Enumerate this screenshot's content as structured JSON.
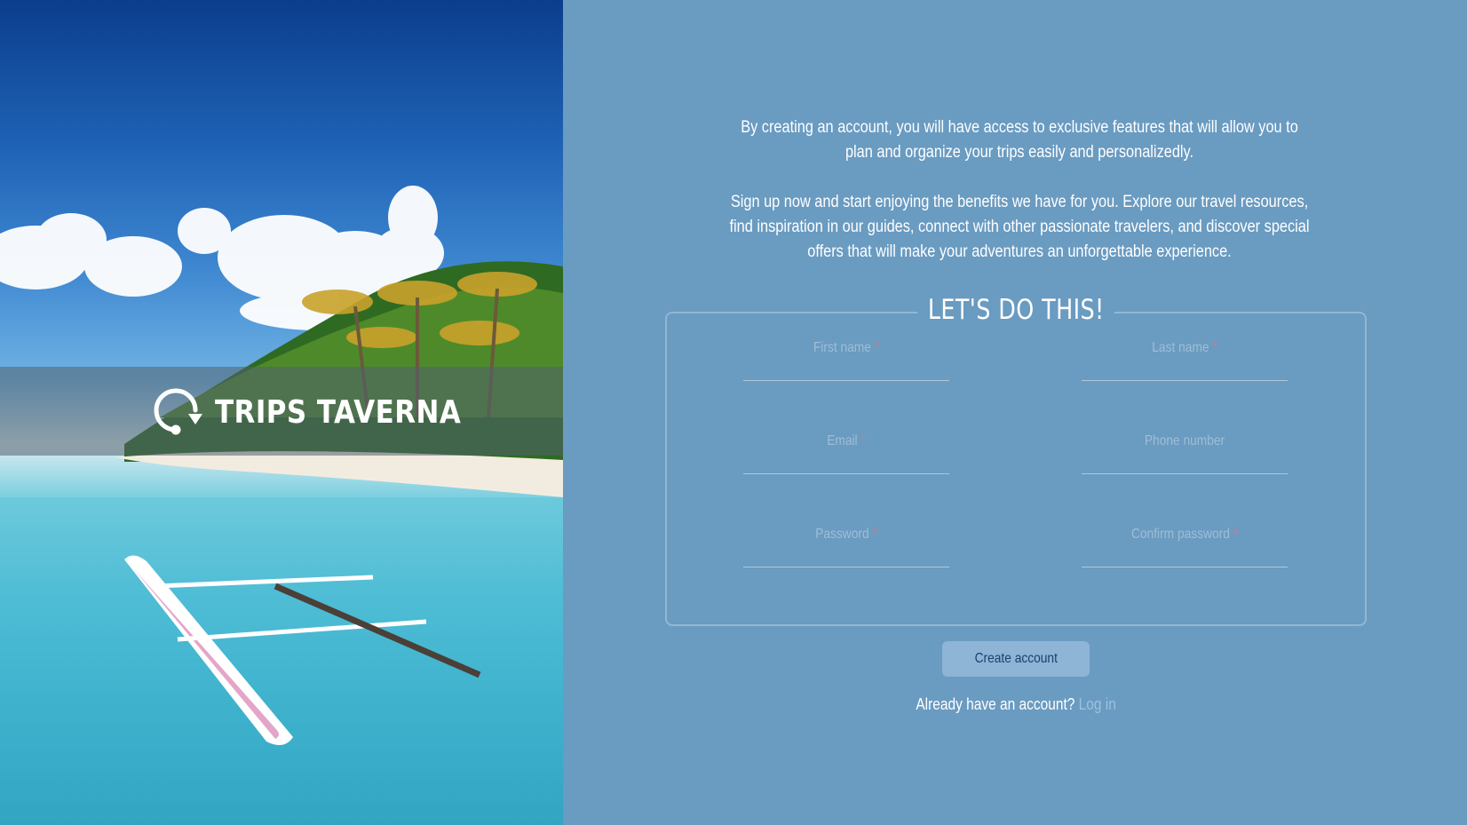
{
  "brand": {
    "name": "TRIPS TAVERNA",
    "logo_icon": "location-loop-icon"
  },
  "intro": {
    "paragraph1": "By creating an account, you will have access to exclusive features that will allow you to plan and organize your trips easily and personalizedly.",
    "paragraph2": "Sign up now and start enjoying the benefits we have for you. Explore our travel resources, find inspiration in our guides, connect with other passionate travelers, and discover special offers that will make your adventures an unforgettable experience."
  },
  "form": {
    "title": "LET'S DO THIS!",
    "fields": {
      "first_name": {
        "label": "First name",
        "required_mark": "*",
        "value": ""
      },
      "last_name": {
        "label": "Last name",
        "required_mark": "*",
        "value": ""
      },
      "email": {
        "label": "Email",
        "required_mark": "*",
        "value": ""
      },
      "phone": {
        "label": "Phone number",
        "required_mark": "",
        "value": ""
      },
      "password": {
        "label": "Password",
        "required_mark": "*",
        "value": ""
      },
      "confirm_password": {
        "label": "Confirm password",
        "required_mark": "*",
        "value": ""
      }
    },
    "submit_label": "Create account"
  },
  "login": {
    "prompt": "Already have an account?",
    "link_label": "Log in"
  },
  "colors": {
    "panel_bg": "#6a9bc1",
    "button_bg": "#8eb5d6",
    "button_text": "#1b3f6f",
    "required": "#ff6e6e",
    "link": "#9cc2e0"
  }
}
